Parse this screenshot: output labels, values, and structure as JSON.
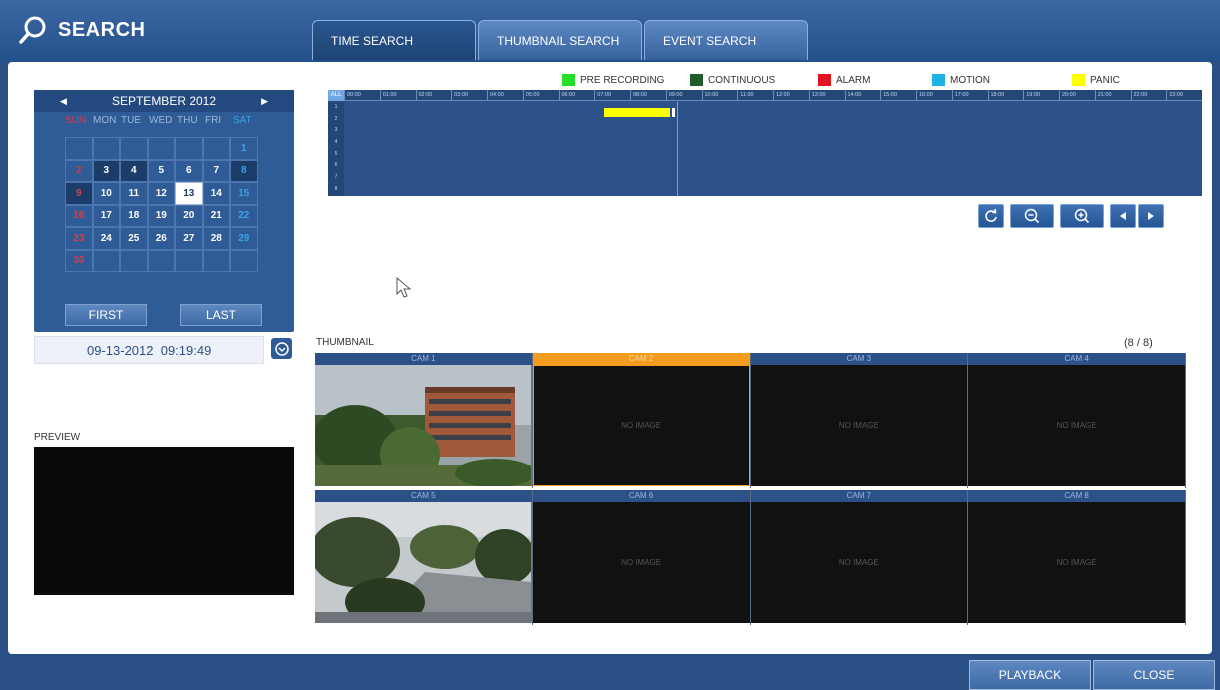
{
  "header": {
    "title": "SEARCH"
  },
  "tabs": [
    {
      "label": "TIME SEARCH",
      "active": true
    },
    {
      "label": "THUMBNAIL SEARCH",
      "active": false
    },
    {
      "label": "EVENT SEARCH",
      "active": false
    }
  ],
  "calendar": {
    "month_label": "SEPTEMBER 2012",
    "weekdays": [
      "SUN",
      "MON",
      "TUE",
      "WED",
      "THU",
      "FRI",
      "SAT"
    ],
    "weeks": [
      [
        "",
        "",
        "",
        "",
        "",
        "",
        "1"
      ],
      [
        "2",
        "3",
        "4",
        "5",
        "6",
        "7",
        "8"
      ],
      [
        "9",
        "10",
        "11",
        "12",
        "13",
        "14",
        "15"
      ],
      [
        "16",
        "17",
        "18",
        "19",
        "20",
        "21",
        "22"
      ],
      [
        "23",
        "24",
        "25",
        "26",
        "27",
        "28",
        "29"
      ],
      [
        "30",
        "",
        "",
        "",
        "",
        "",
        ""
      ]
    ],
    "selected_day": "13",
    "first_label": "FIRST",
    "last_label": "LAST"
  },
  "datetime": "09-13-2012  09:19:49",
  "preview_label": "PREVIEW",
  "legend": [
    {
      "label": "PRE RECORDING",
      "color": "#22e022"
    },
    {
      "label": "CONTINUOUS",
      "color": "#1e5a2a"
    },
    {
      "label": "ALARM",
      "color": "#e0141e"
    },
    {
      "label": "MOTION",
      "color": "#1ab4e8"
    },
    {
      "label": "PANIC",
      "color": "#ffff00"
    }
  ],
  "timeline": {
    "all_label": "ALL",
    "hours": [
      "00:00",
      "01:00",
      "02:00",
      "03:00",
      "04:00",
      "05:00",
      "06:00",
      "07:00",
      "08:00",
      "09:00",
      "10:00",
      "11:00",
      "12:00",
      "13:00",
      "14:00",
      "15:00",
      "16:00",
      "17:00",
      "18:00",
      "19:00",
      "20:00",
      "21:00",
      "22:00",
      "23:00"
    ],
    "channels": [
      "1",
      "2",
      "3",
      "4",
      "5",
      "6",
      "7",
      "8"
    ]
  },
  "controls": {
    "refresh_icon": "refresh-icon",
    "zoom_out_icon": "zoom-out-icon",
    "zoom_in_icon": "zoom-in-icon",
    "prev_icon": "prev-icon",
    "next_icon": "next-icon"
  },
  "thumbnails": {
    "label": "THUMBNAIL",
    "count": "(8 / 8)",
    "cams": [
      {
        "name": "CAM 1",
        "image": true
      },
      {
        "name": "CAM 2",
        "image": false,
        "selected": true
      },
      {
        "name": "CAM 3",
        "image": false
      },
      {
        "name": "CAM 4",
        "image": false
      },
      {
        "name": "CAM 5",
        "image": true
      },
      {
        "name": "CAM 6",
        "image": false
      },
      {
        "name": "CAM 7",
        "image": false
      },
      {
        "name": "CAM 8",
        "image": false
      }
    ],
    "no_image_text": "NO IMAGE"
  },
  "footer": {
    "playback_label": "PLAYBACK",
    "close_label": "CLOSE"
  }
}
